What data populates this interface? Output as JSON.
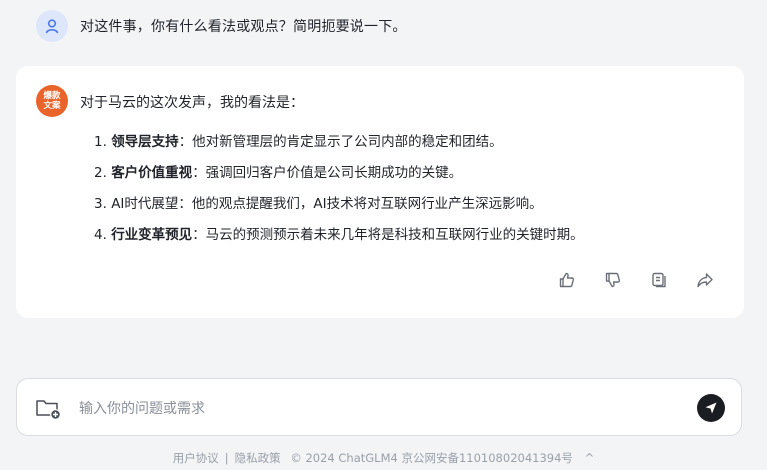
{
  "user_message": {
    "avatar_icon": "user-icon",
    "text": "对这件事，你有什么看法或观点？简明扼要说一下。"
  },
  "answer": {
    "avatar_text": "爆款文案",
    "avatar_color": "#e8642a",
    "intro": "对于马云的这次发声，我的看法是：",
    "points": [
      {
        "num": "1.",
        "title": "领导层支持",
        "text": "：他对新管理层的肯定显示了公司内部的稳定和团结。"
      },
      {
        "num": "2.",
        "title": "客户价值重视",
        "text": "：强调回归客户价值是公司长期成功的关键。"
      },
      {
        "num": "3.",
        "title": "",
        "plain": "AI时代展望：他的观点提醒我们，AI技术将对互联网行业产生深远影响。",
        "text": ""
      },
      {
        "num": "4.",
        "title": "行业变革预见",
        "text": "：马云的预测预示着未来几年将是科技和互联网行业的关键时期。"
      }
    ],
    "actions": [
      "thumbs-up-icon",
      "thumbs-down-icon",
      "copy-icon",
      "share-icon"
    ]
  },
  "composer": {
    "placeholder": "输入你的问题或需求",
    "attach_icon": "folder-add-icon",
    "send_icon": "send-icon"
  },
  "footer": {
    "user_agreement": "用户协议",
    "divider": "|",
    "privacy": "隐私政策",
    "copyright": "© 2024 ChatGLM4 京公网安备11010802041394号",
    "toggle": "^"
  }
}
